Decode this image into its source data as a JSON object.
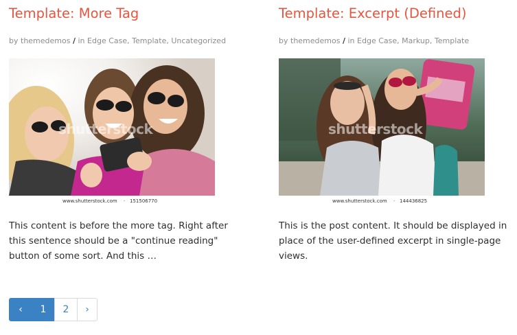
{
  "posts": [
    {
      "title": "Template: More Tag",
      "meta": {
        "by": "by",
        "author": "themedemos",
        "separator": "/",
        "in": "in",
        "categories": [
          "Edge Case",
          "Template",
          "Uncategorized"
        ]
      },
      "image": {
        "watermark": "shutterstock",
        "caption_site": "www.shutterstock.com",
        "caption_sep": "·",
        "caption_id": "151506770"
      },
      "excerpt": "This content is before the more tag. Right after this sentence should be a \"continue reading\" button of some sort. And this …"
    },
    {
      "title": "Template: Excerpt (Defined)",
      "meta": {
        "by": "by",
        "author": "themedemos",
        "separator": "/",
        "in": "in",
        "categories": [
          "Edge Case",
          "Markup",
          "Template"
        ]
      },
      "image": {
        "watermark": "shutterstock",
        "caption_site": "www.shutterstock.com",
        "caption_sep": "·",
        "caption_id": "144436825"
      },
      "excerpt": "This is the post content. It should be displayed in place of the user-defined excerpt in single-page views."
    }
  ],
  "pagination": {
    "prev": "‹",
    "pages": [
      "1",
      "2"
    ],
    "current": "1",
    "next": "›"
  },
  "colors": {
    "title": "#e8553e",
    "accent": "#3b82c4",
    "meta": "#8c8c8c"
  }
}
